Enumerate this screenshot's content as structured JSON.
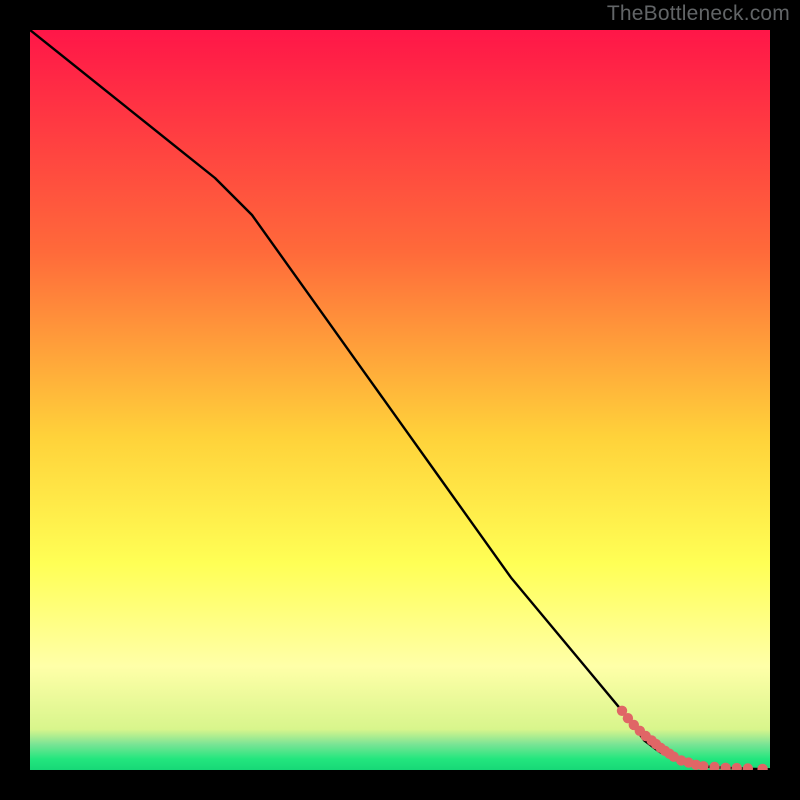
{
  "watermark": "TheBottleneck.com",
  "colors": {
    "bg_black": "#000000",
    "grad_top": "#ff1648",
    "grad_mid_upper": "#ff8a3a",
    "grad_mid": "#ffd93a",
    "grad_mid_lower": "#ffff66",
    "grad_pale": "#ffffa8",
    "grad_green": "#23e67e",
    "line": "#000000",
    "marker": "#e06666"
  },
  "chart_data": {
    "type": "line",
    "title": "",
    "xlabel": "",
    "ylabel": "",
    "xlim": [
      0,
      100
    ],
    "ylim": [
      0,
      100
    ],
    "series": [
      {
        "name": "curve",
        "x": [
          0,
          5,
          10,
          15,
          20,
          25,
          30,
          35,
          40,
          45,
          50,
          55,
          60,
          65,
          70,
          75,
          80,
          83,
          85,
          87,
          88,
          90,
          92,
          94,
          96,
          98,
          100
        ],
        "y": [
          100,
          96,
          92,
          88,
          84,
          80,
          75,
          68,
          61,
          54,
          47,
          40,
          33,
          26,
          20,
          14,
          8,
          4,
          2.5,
          1.5,
          1.0,
          0.6,
          0.4,
          0.3,
          0.2,
          0.15,
          0.1
        ]
      }
    ],
    "markers": {
      "name": "highlight-points",
      "x": [
        80.0,
        80.8,
        81.6,
        82.4,
        83.2,
        84.0,
        84.6,
        85.2,
        85.8,
        86.4,
        87.0,
        88.0,
        89.0,
        90.0,
        91.0,
        92.5,
        94.0,
        95.5,
        97.0,
        99.0
      ],
      "y": [
        8.0,
        7.0,
        6.1,
        5.3,
        4.6,
        4.0,
        3.5,
        3.0,
        2.6,
        2.2,
        1.8,
        1.3,
        1.0,
        0.7,
        0.5,
        0.4,
        0.3,
        0.25,
        0.2,
        0.15
      ]
    },
    "background_gradient_stops": [
      {
        "offset": 0.0,
        "color": "#ff1648"
      },
      {
        "offset": 0.3,
        "color": "#ff6a3a"
      },
      {
        "offset": 0.55,
        "color": "#ffd23a"
      },
      {
        "offset": 0.72,
        "color": "#ffff55"
      },
      {
        "offset": 0.86,
        "color": "#ffffa8"
      },
      {
        "offset": 0.945,
        "color": "#d8f58c"
      },
      {
        "offset": 0.965,
        "color": "#7be495"
      },
      {
        "offset": 0.985,
        "color": "#23e67e"
      },
      {
        "offset": 1.0,
        "color": "#17d877"
      }
    ]
  }
}
